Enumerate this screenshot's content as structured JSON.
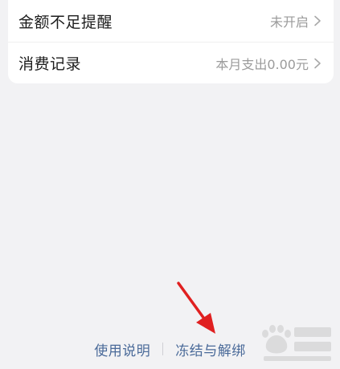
{
  "settings_list": {
    "items": [
      {
        "label": "金额不足提醒",
        "value": "未开启"
      },
      {
        "label": "消费记录",
        "value": "本月支出0.00元"
      }
    ]
  },
  "footer": {
    "usage_label": "使用说明",
    "freeze_label": "冻结与解绑"
  },
  "colors": {
    "link": "#4a6a99",
    "annotation_arrow": "#e02020"
  },
  "icons": {
    "row_chevron": "chevron-right-icon",
    "watermark": "baidu-paw-logo"
  }
}
